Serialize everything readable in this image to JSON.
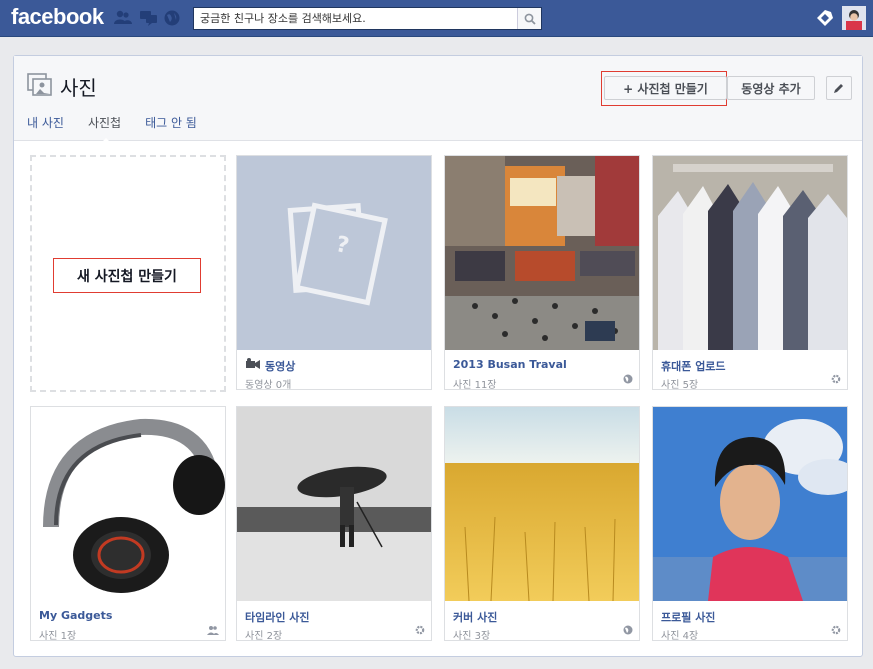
{
  "topbar": {
    "logo": "facebook",
    "search_placeholder": "궁금한 친구나 장소를 검색해보세요."
  },
  "header": {
    "title": "사진",
    "tabs": [
      "내 사진",
      "사진첩",
      "태그 안 됨"
    ],
    "active_tab": "사진첩",
    "create_album_label": "+ 사진첩 만들기",
    "add_video_label": "동영상 추가"
  },
  "new_album_label": "새 사진첩 만들기",
  "albums": [
    {
      "name": "동영상",
      "count": "동영상 0개",
      "icon": "video-camera-icon",
      "privacy": ""
    },
    {
      "name": "2013 Busan Traval",
      "count": "사진 11장",
      "privacy": "globe-icon"
    },
    {
      "name": "휴대폰 업로드",
      "count": "사진 5장",
      "privacy": "gear-icon"
    },
    {
      "name": "My Gadgets",
      "count": "사진 1장",
      "privacy": "friends-icon"
    },
    {
      "name": "타임라인 사진",
      "count": "사진 2장",
      "privacy": "gear-icon"
    },
    {
      "name": "커버 사진",
      "count": "사진 3장",
      "privacy": "globe-icon"
    },
    {
      "name": "프로필 사진",
      "count": "사진 4장",
      "privacy": "gear-icon"
    }
  ],
  "colors": {
    "brand": "#3b5998",
    "highlight": "#e03c31"
  }
}
